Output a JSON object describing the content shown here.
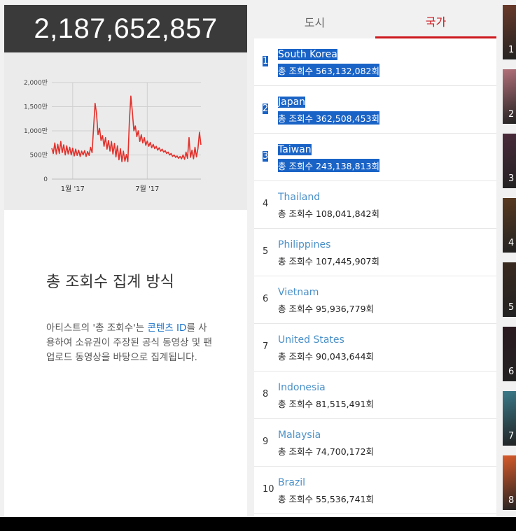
{
  "total": {
    "value": "2,187,652,857"
  },
  "chart_data": {
    "type": "line",
    "x_ticks": [
      "1월 '17",
      "7월 '17"
    ],
    "y_ticks": [
      "2,000만",
      "1,500만",
      "1,000만",
      "500만",
      "0"
    ],
    "ylim": [
      0,
      20000000
    ],
    "grid": true,
    "series": [
      {
        "color": "#e2302b",
        "values": [
          6400000,
          5300000,
          7500000,
          5200000,
          7200000,
          5300000,
          7800000,
          5500000,
          7100000,
          5000000,
          6900000,
          5200000,
          6600000,
          5000000,
          6400000,
          4800000,
          6200000,
          4900000,
          6000000,
          4700000,
          5800000,
          5000000,
          5900000,
          4700000,
          5700000,
          4900000,
          6600000,
          5500000,
          10500000,
          15700000,
          13500000,
          9200000,
          10500000,
          8000000,
          9000000,
          6800000,
          8600000,
          6200000,
          8000000,
          5800000,
          7800000,
          5200000,
          7400000,
          4600000,
          6900000,
          4000000,
          6300000,
          3600000,
          5800000,
          3700000,
          5100000,
          3600000,
          12000000,
          17200000,
          14000000,
          10000000,
          11000000,
          8800000,
          10000000,
          7800000,
          9200000,
          7500000,
          8600000,
          7000000,
          7900000,
          6800000,
          7600000,
          6500000,
          7200000,
          6300000,
          6800000,
          6000000,
          6500000,
          5800000,
          6200000,
          5600000,
          5900000,
          5300000,
          5600000,
          5000000,
          5300000,
          4700000,
          5000000,
          4500000,
          4800000,
          4300000,
          4700000,
          4200000,
          5000000,
          4100000,
          5600000,
          4300000,
          8600000,
          4500000,
          6000000,
          4200000,
          6600000,
          4600000,
          6300000,
          9700000,
          7100000
        ]
      }
    ],
    "x_tick_index": [
      14,
      64
    ]
  },
  "info": {
    "title": "총 조회수 집계 방식",
    "text_before": "아티스트의 '총 조회수'는 ",
    "link": "콘텐츠 ID",
    "text_after": "를 사용하여 소유권이 주장된 공식 동영상 및 팬 업로드 동영상을 바탕으로 집계됩니다."
  },
  "tabs": [
    {
      "label": "도시",
      "active": false
    },
    {
      "label": "국가",
      "active": true
    }
  ],
  "rankings": [
    {
      "rank": "1",
      "country": "South Korea",
      "views": "총 조회수 563,132,082회",
      "selected": true
    },
    {
      "rank": "2",
      "country": "Japan",
      "views": "총 조회수 362,508,453회",
      "selected": true
    },
    {
      "rank": "3",
      "country": "Taiwan",
      "views": "총 조회수 243,138,813회",
      "selected": true
    },
    {
      "rank": "4",
      "country": "Thailand",
      "views": "총 조회수 108,041,842회",
      "selected": false
    },
    {
      "rank": "5",
      "country": "Philippines",
      "views": "총 조회수 107,445,907회",
      "selected": false
    },
    {
      "rank": "6",
      "country": "Vietnam",
      "views": "총 조회수 95,936,779회",
      "selected": false
    },
    {
      "rank": "7",
      "country": "United States",
      "views": "총 조회수 90,043,644회",
      "selected": false
    },
    {
      "rank": "8",
      "country": "Indonesia",
      "views": "총 조회수 81,515,491회",
      "selected": false
    },
    {
      "rank": "9",
      "country": "Malaysia",
      "views": "총 조회수 74,700,172회",
      "selected": false
    },
    {
      "rank": "10",
      "country": "Brazil",
      "views": "총 조회수 55,536,741회",
      "selected": false
    }
  ],
  "thumbnails": [
    {
      "num": "1",
      "color": "#6b3a2a"
    },
    {
      "num": "2",
      "color": "#b3707a"
    },
    {
      "num": "3",
      "color": "#4a2a3a"
    },
    {
      "num": "4",
      "color": "#5a3a20"
    },
    {
      "num": "5",
      "color": "#3a2a20"
    },
    {
      "num": "6",
      "color": "#2a1a20"
    },
    {
      "num": "7",
      "color": "#3a7a8a"
    },
    {
      "num": "8",
      "color": "#d85a2a"
    }
  ]
}
